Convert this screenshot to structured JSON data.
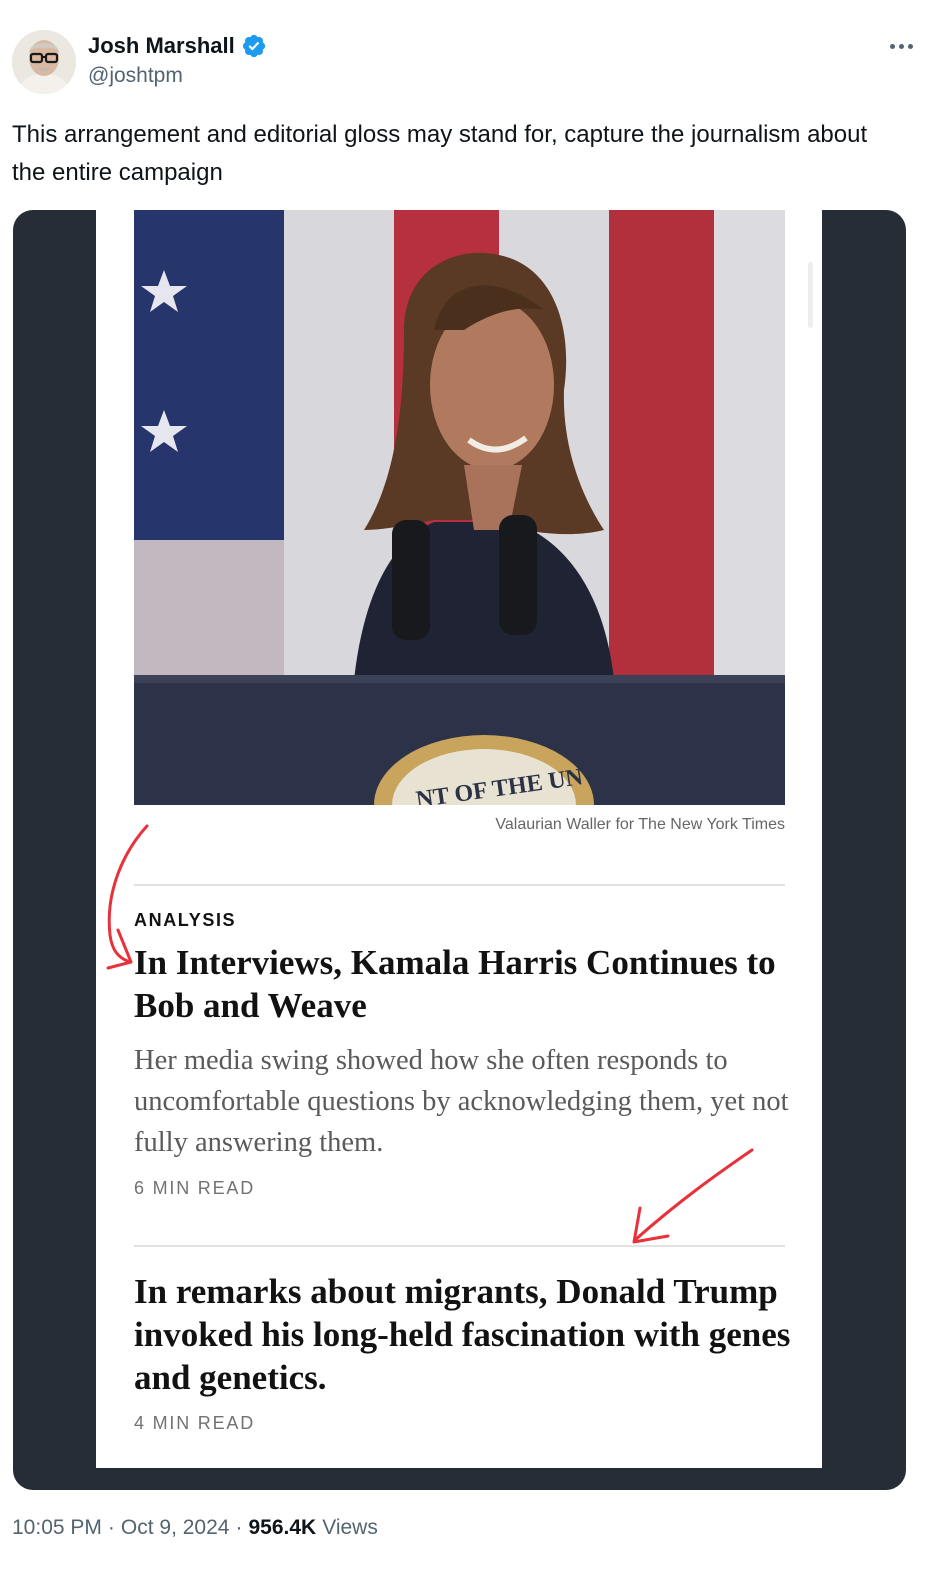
{
  "author": {
    "name": "Josh Marshall",
    "handle": "@joshtpm",
    "verified": true,
    "avatar_icon": "avatar-photo"
  },
  "more_icon": "more-horizontal-icon",
  "tweet": {
    "text": "This arrangement and editorial gloss may stand for, capture the journalism about the entire campaign"
  },
  "screenshot": {
    "photo_credit": "Valaurian Waller for The New York Times",
    "seal_text": "NT OF THE UN",
    "articles": [
      {
        "kicker": "ANALYSIS",
        "headline": "In Interviews, Kamala Harris Continues to Bob and Weave",
        "summary": "Her media swing showed how she often responds to uncomfortable questions by acknowledging them, yet not fully answering them.",
        "read_time": "6 MIN READ"
      },
      {
        "headline": "In remarks about migrants, Donald Trump invoked his long-held fascination with genes and genetics.",
        "read_time": "4 MIN READ"
      }
    ],
    "annotation_color": "#e8313a"
  },
  "meta": {
    "time": "10:05 PM",
    "date": "Oct 9, 2024",
    "separator": "·",
    "views_count": "956.4K",
    "views_label": "Views"
  },
  "colors": {
    "verified_blue": "#1d9bf0",
    "secondary_text": "#536471",
    "media_background": "#262d36"
  }
}
